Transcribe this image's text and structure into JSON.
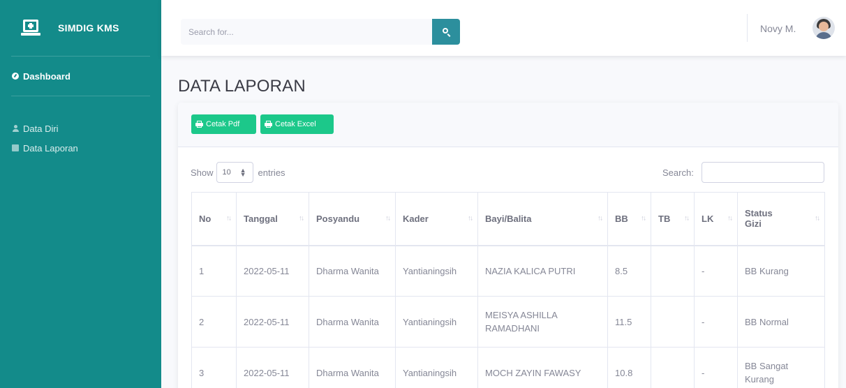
{
  "sidebar": {
    "brand": "SIMDIG KMS",
    "items": [
      {
        "label": "Dashboard",
        "icon": "dashboard-icon"
      },
      {
        "label": "Data Diri",
        "icon": "user-icon"
      },
      {
        "label": "Data Laporan",
        "icon": "book-icon"
      }
    ]
  },
  "topbar": {
    "search_placeholder": "Search for...",
    "user_name": "Novy M."
  },
  "page": {
    "title": "DATA LAPORAN"
  },
  "card": {
    "btn_pdf": "Cetak Pdf",
    "btn_excel": "Cetak Excel",
    "show_label": "Show",
    "entries_value": "10",
    "entries_label": "entries",
    "search_label": "Search:"
  },
  "table": {
    "headers": [
      "No",
      "Tanggal",
      "Posyandu",
      "Kader",
      "Bayi/Balita",
      "BB",
      "TB",
      "LK",
      "Status Gizi"
    ],
    "rows": [
      [
        "1",
        "2022-05-11",
        "Dharma Wanita",
        "Yantianingsih",
        "NAZIA KALICA PUTRI",
        "8.5",
        "",
        "-",
        "BB Kurang"
      ],
      [
        "2",
        "2022-05-11",
        "Dharma Wanita",
        "Yantianingsih",
        "MEISYA ASHILLA RAMADHANI",
        "11.5",
        "",
        "-",
        "BB Normal"
      ],
      [
        "3",
        "2022-05-11",
        "Dharma Wanita",
        "Yantianingsih",
        "MOCH ZAYIN FAWASY",
        "10.8",
        "",
        "-",
        "BB Sangat Kurang"
      ]
    ]
  },
  "colors": {
    "sidebar": "#138b8a",
    "accent": "#2c8f9d",
    "success": "#1cc88a"
  }
}
